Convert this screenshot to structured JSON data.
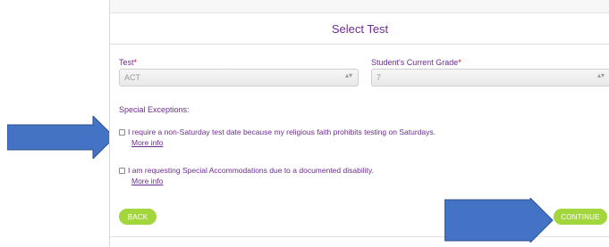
{
  "header": {
    "title": "Select Test"
  },
  "form": {
    "test_label": "Test",
    "test_value": "ACT",
    "grade_label": "Student's Current Grade",
    "grade_value": "7",
    "required_marker": "*",
    "select_arrows": "▴▾"
  },
  "exceptions": {
    "title": "Special Exceptions:",
    "options": [
      {
        "label": "I require a non-Saturday test date because my religious faith prohibits testing on Saturdays.",
        "link": "More info"
      },
      {
        "label": "I am requesting Special Accommodations due to a documented disability.",
        "link": "More info"
      }
    ]
  },
  "buttons": {
    "back": "BACK",
    "continue": "CONTINUE"
  },
  "colors": {
    "accent": "#6b2c91",
    "button": "#a3d63d",
    "required": "#d0021b",
    "callout": "#4472c4"
  },
  "icons": [
    "checkbox-icon",
    "select-arrows-icon",
    "callout-arrow"
  ]
}
